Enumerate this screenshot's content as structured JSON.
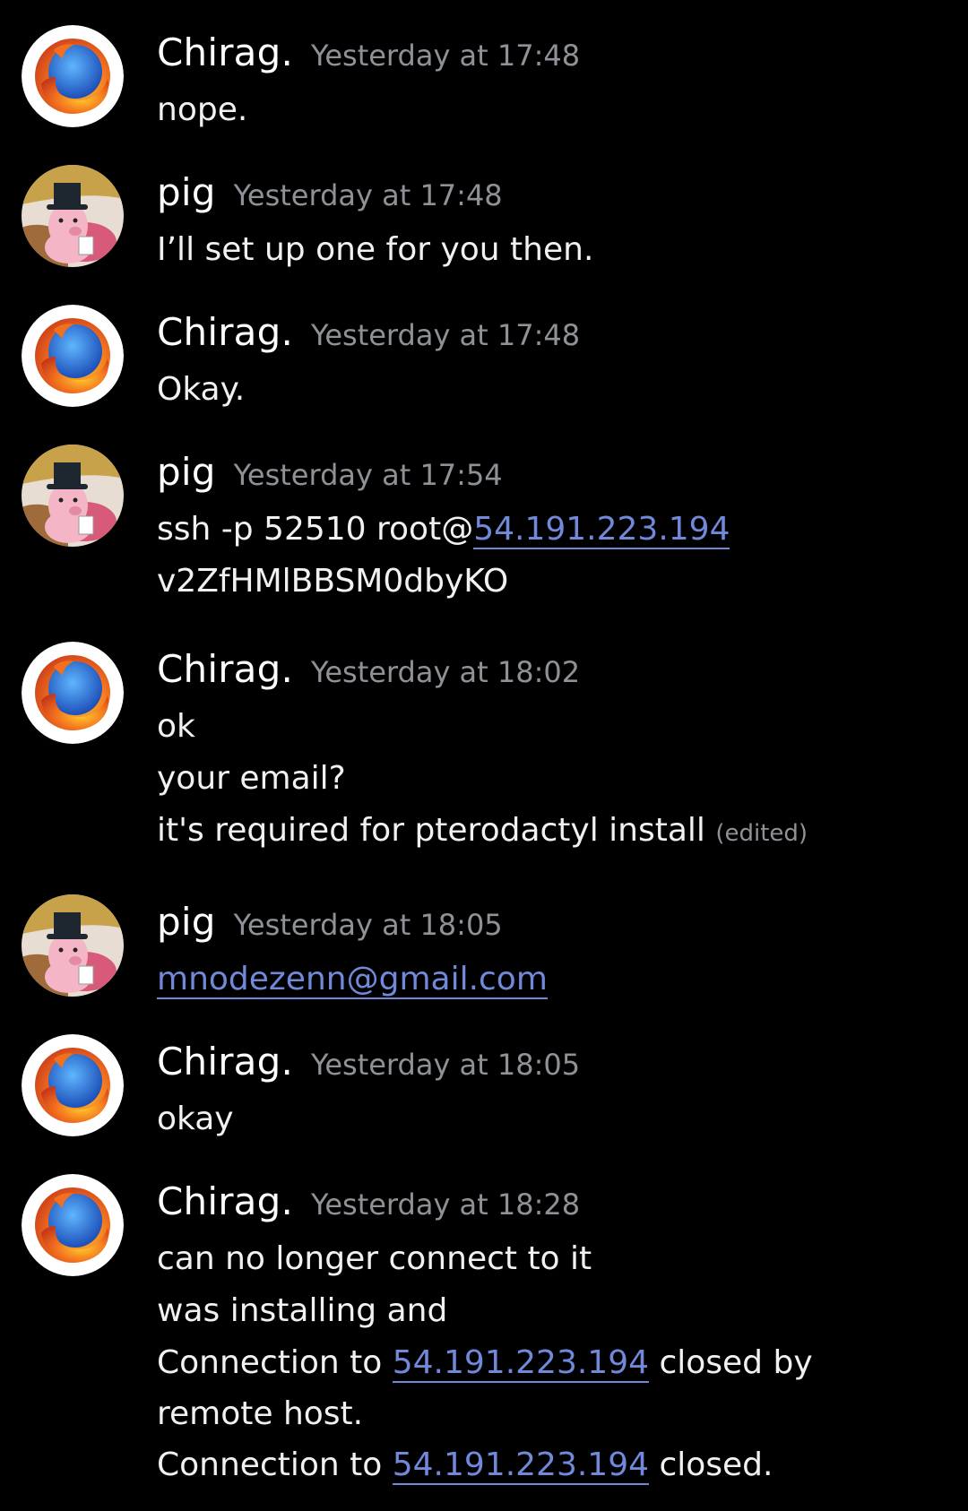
{
  "messages": [
    {
      "author": "Chirag.",
      "timestamp": "Yesterday at 17:48",
      "avatar": "firefox-avatar",
      "lines": [
        "nope."
      ]
    },
    {
      "author": "pig",
      "timestamp": "Yesterday at 17:48",
      "avatar": "pig-avatar",
      "lines": [
        "I’ll set up one for you then."
      ]
    },
    {
      "author": "Chirag.",
      "timestamp": "Yesterday at 17:48",
      "avatar": "firefox-avatar",
      "lines": [
        "Okay."
      ]
    },
    {
      "author": "pig",
      "timestamp": "Yesterday at 17:54",
      "avatar": "pig-avatar",
      "ssh_prefix": "ssh -p 52510 root@",
      "ssh_link": "54.191.223.194",
      "password": "v2ZfHMlBBSM0dbyKO"
    },
    {
      "author": "Chirag.",
      "timestamp": "Yesterday at 18:02",
      "avatar": "firefox-avatar",
      "lines": [
        "ok",
        "your email?"
      ],
      "last_line": "it's required for pterodactyl install",
      "edited": "(edited)"
    },
    {
      "author": "pig",
      "timestamp": "Yesterday at 18:05",
      "avatar": "pig-avatar",
      "email_link": "mnodezenn@gmail.com"
    },
    {
      "author": "Chirag.",
      "timestamp": "Yesterday at 18:05",
      "avatar": "firefox-avatar",
      "lines": [
        "okay"
      ]
    },
    {
      "author": "Chirag.",
      "timestamp": "Yesterday at 18:28",
      "avatar": "firefox-avatar",
      "lines": [
        "can no longer connect to it",
        "was installing and"
      ],
      "conn1_prefix": "Connection to ",
      "conn1_link": "54.191.223.194",
      "conn1_suffix": " closed by remote host.",
      "conn2_prefix": "Connection to ",
      "conn2_link": "54.191.223.194",
      "conn2_suffix": " closed."
    }
  ],
  "colors": {
    "background": "#000000",
    "text": "#f1f1f1",
    "timestamp": "#8e9297",
    "link": "#7289da"
  }
}
